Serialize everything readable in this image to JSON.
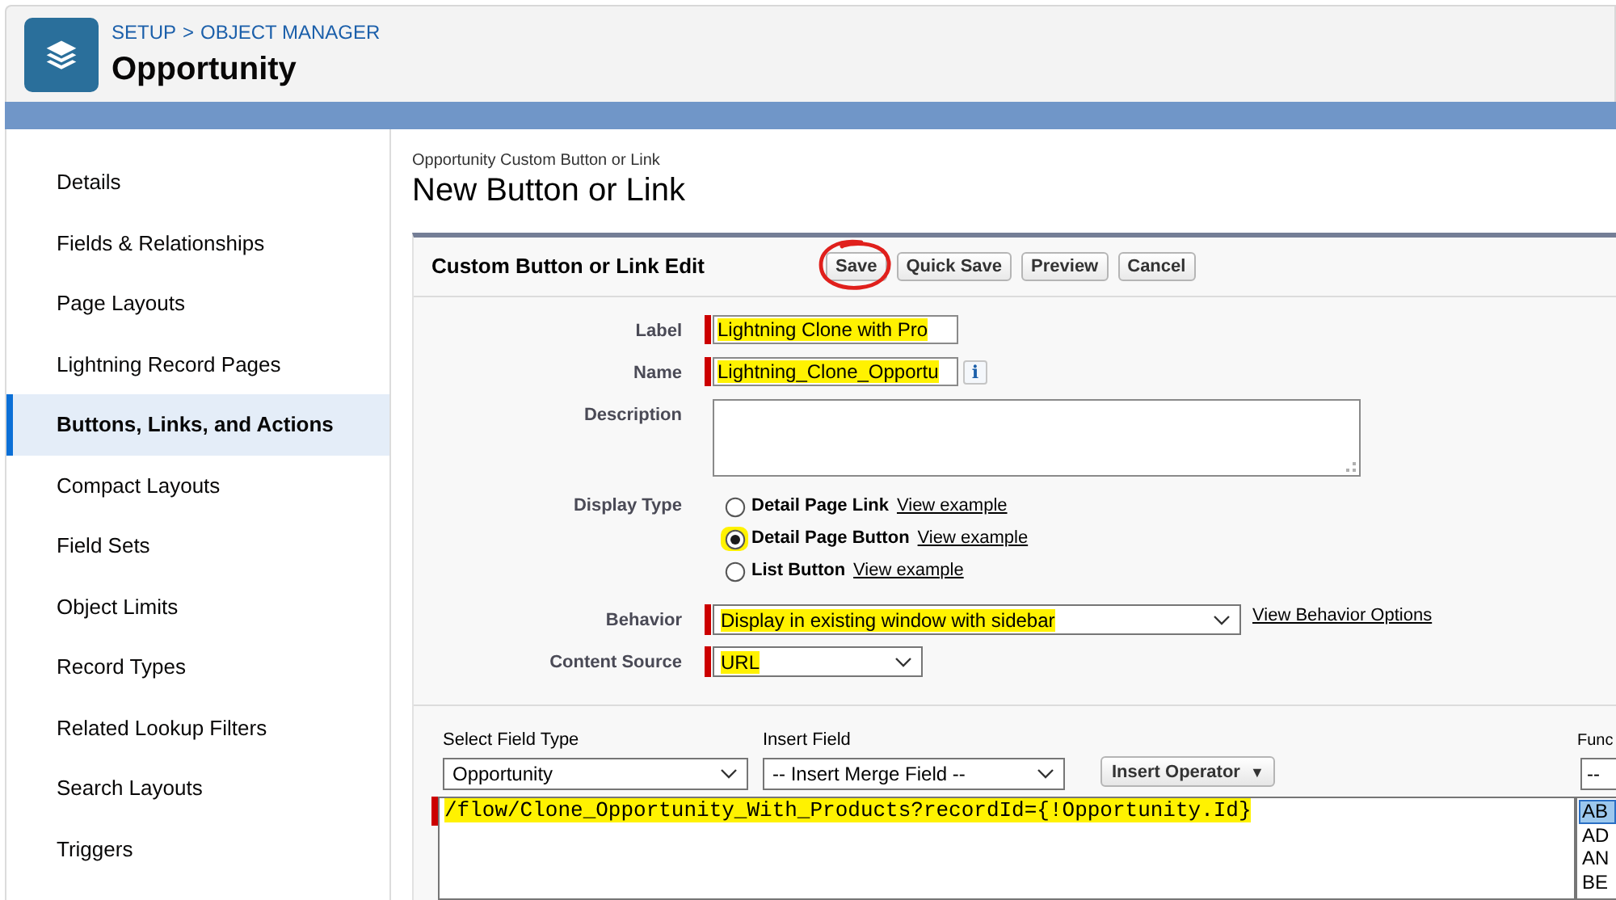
{
  "header": {
    "breadcrumb": [
      "SETUP",
      "OBJECT MANAGER"
    ],
    "separator": ">",
    "title": "Opportunity"
  },
  "sidebar": {
    "items": [
      {
        "label": "Details",
        "selected": false
      },
      {
        "label": "Fields & Relationships",
        "selected": false
      },
      {
        "label": "Page Layouts",
        "selected": false
      },
      {
        "label": "Lightning Record Pages",
        "selected": false
      },
      {
        "label": "Buttons, Links, and Actions",
        "selected": true
      },
      {
        "label": "Compact Layouts",
        "selected": false
      },
      {
        "label": "Field Sets",
        "selected": false
      },
      {
        "label": "Object Limits",
        "selected": false
      },
      {
        "label": "Record Types",
        "selected": false
      },
      {
        "label": "Related Lookup Filters",
        "selected": false
      },
      {
        "label": "Search Layouts",
        "selected": false
      },
      {
        "label": "Triggers",
        "selected": false
      }
    ]
  },
  "page": {
    "subtitle": "Opportunity Custom Button or Link",
    "title": "New Button or Link"
  },
  "edit_panel": {
    "title": "Custom Button or Link Edit",
    "buttons": [
      {
        "label": "Save",
        "circled": true
      },
      {
        "label": "Quick Save",
        "circled": false
      },
      {
        "label": "Preview",
        "circled": false
      },
      {
        "label": "Cancel",
        "circled": false
      }
    ],
    "fields": [
      {
        "kind": "text",
        "label": "Label",
        "value": "Lightning Clone with Pro",
        "required": true,
        "highlighted": true
      },
      {
        "kind": "text",
        "label": "Name",
        "value": "Lightning_Clone_Opportu",
        "required": true,
        "highlighted": true,
        "info": "i"
      },
      {
        "kind": "textarea",
        "label": "Description"
      },
      {
        "kind": "radio",
        "label": "Display Type",
        "options": [
          {
            "label": "Detail Page Link",
            "link": "View example",
            "selected": false,
            "highlighted": false
          },
          {
            "label": "Detail Page Button",
            "link": "View example",
            "selected": true,
            "highlighted": true
          },
          {
            "label": "List Button",
            "link": "View example",
            "selected": false,
            "highlighted": false
          }
        ]
      },
      {
        "kind": "select",
        "label": "Behavior",
        "value": "Display in existing window with sidebar",
        "required": true,
        "highlighted": true,
        "link": "View Behavior Options"
      },
      {
        "kind": "select",
        "label": "Content Source",
        "value": "URL",
        "required": true,
        "highlighted": true
      }
    ]
  },
  "formula_editor": {
    "field_type": {
      "label": "Select Field Type",
      "value": "Opportunity"
    },
    "insert_field": {
      "label": "Insert Field",
      "value": "-- Insert Merge Field --"
    },
    "insert_operator": {
      "label": "Insert Operator",
      "caret": "▼"
    },
    "functions": {
      "label": "Func",
      "value": "--",
      "items": [
        {
          "label": "AB",
          "selected": true
        },
        {
          "label": "AD",
          "selected": false
        },
        {
          "label": "AN",
          "selected": false
        },
        {
          "label": "BE",
          "selected": false
        }
      ]
    },
    "formula": {
      "value": "/flow/Clone_Opportunity_With_Products?recordId={!Opportunity.Id}",
      "required": true,
      "highlighted": true
    }
  }
}
